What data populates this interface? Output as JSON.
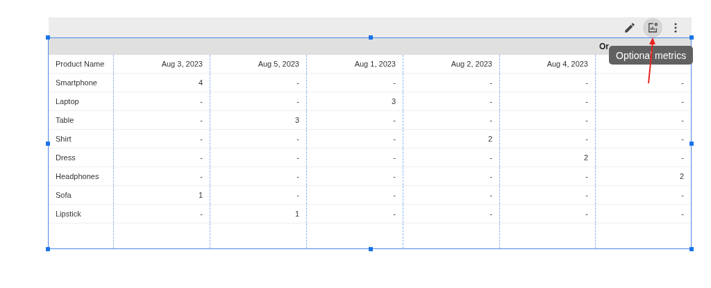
{
  "toolbar": {
    "tooltip": "Optional metrics",
    "metrics_selected": true
  },
  "table": {
    "header_band": "Or",
    "columns": [
      "Product Name",
      "Aug 3, 2023",
      "Aug 5, 2023",
      "Aug 1, 2023",
      "Aug 2, 2023",
      "Aug 4, 2023",
      ""
    ],
    "rows": [
      [
        "Smartphone",
        "4",
        "-",
        "-",
        "-",
        "-",
        "-"
      ],
      [
        "Laptop",
        "-",
        "-",
        "3",
        "-",
        "-",
        "-"
      ],
      [
        "Table",
        "-",
        "3",
        "-",
        "-",
        "-",
        "-"
      ],
      [
        "Shirt",
        "-",
        "-",
        "-",
        "2",
        "-",
        "-"
      ],
      [
        "Dress",
        "-",
        "-",
        "-",
        "-",
        "2",
        "-"
      ],
      [
        "Headphones",
        "-",
        "-",
        "-",
        "-",
        "-",
        "2"
      ],
      [
        "Sofa",
        "1",
        "-",
        "-",
        "-",
        "-",
        "-"
      ],
      [
        "Lipstick",
        "-",
        "1",
        "-",
        "-",
        "-",
        "-"
      ]
    ]
  }
}
